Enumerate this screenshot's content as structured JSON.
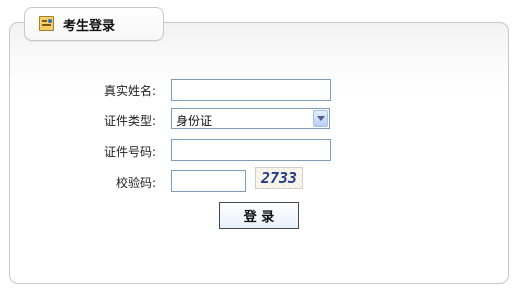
{
  "panel": {
    "title": "考生登录"
  },
  "form": {
    "name_label": "真实姓名:",
    "name_value": "",
    "id_type_label": "证件类型:",
    "id_type_value": "身份证",
    "id_no_label": "证件号码:",
    "id_no_value": "",
    "captcha_label": "校验码:",
    "captcha_value": "",
    "captcha_image_text": "2733",
    "login_label": "登 录"
  }
}
